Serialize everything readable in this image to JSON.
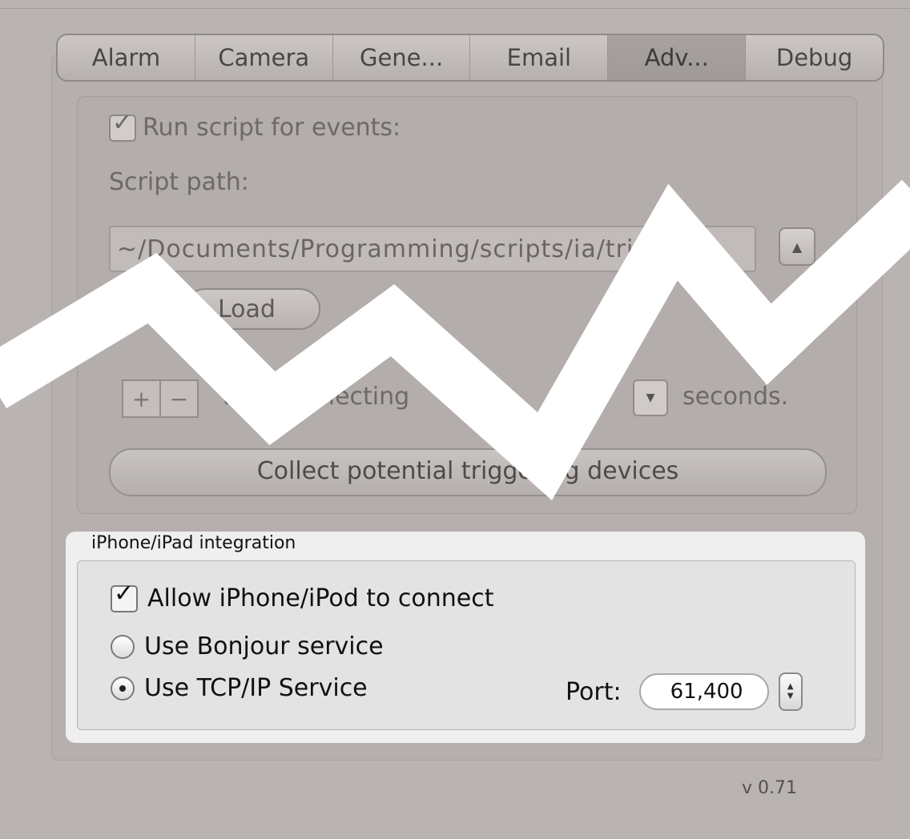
{
  "tabs": [
    {
      "label": "Alarm"
    },
    {
      "label": "Camera"
    },
    {
      "label": "Gene..."
    },
    {
      "label": "Email"
    },
    {
      "label": "Adv..."
    },
    {
      "label": "Debug"
    }
  ],
  "script": {
    "run_script_label": "Run script for events:",
    "run_script_checked": true,
    "script_path_label": "Script path:",
    "script_path_value": "~/Documents/Programming/scripts/ia/trig",
    "load_button_label": "Load",
    "collect_label": "when collecting",
    "seconds_label": "seconds.",
    "collect_button_label": "Collect potential triggering devices"
  },
  "iphone": {
    "group_title": "iPhone/iPad integration",
    "allow_label": "Allow iPhone/iPod to connect",
    "allow_checked": true,
    "bonjour_label": "Use Bonjour service",
    "tcp_label": "Use TCP/IP Service",
    "selected_service": "tcp",
    "port_label": "Port:",
    "port_value": "61,400"
  },
  "version": "v 0.71",
  "colors": {
    "background": "#b9b3b1",
    "group_background": "#efefef",
    "overlay_stroke": "#ffffff"
  },
  "icons": {
    "checkmark": "checkmark-icon",
    "up_arrow": "triangle-up-icon",
    "dropdown": "triangle-down-icon"
  }
}
